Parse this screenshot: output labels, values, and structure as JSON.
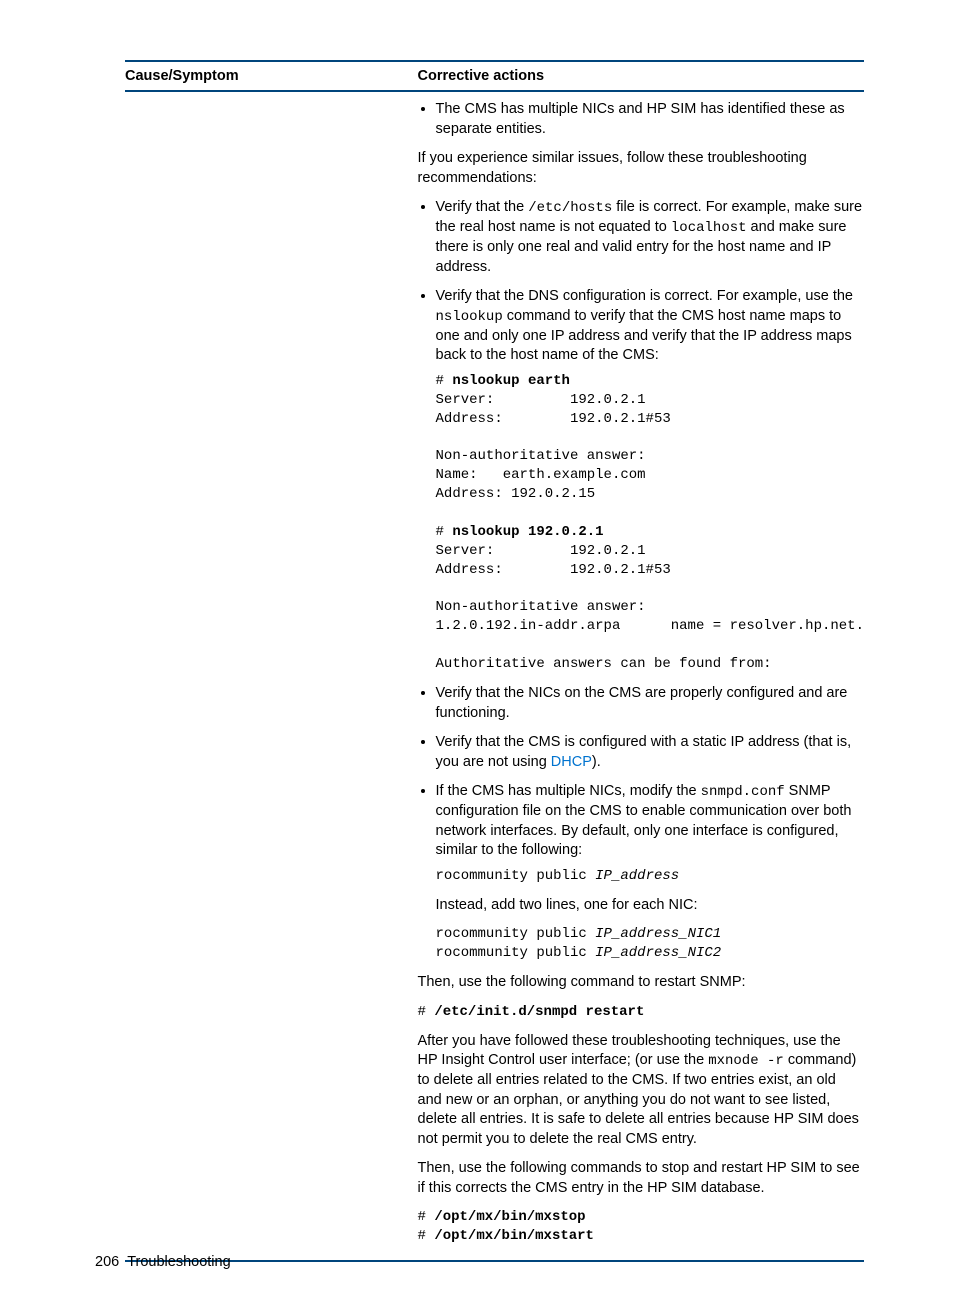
{
  "headers": {
    "col1": "Cause/Symptom",
    "col2": "Corrective actions"
  },
  "content": {
    "bullet_cms_nics": "The CMS has multiple NICs and HP SIM has identified these as separate entities.",
    "intro_troubleshoot": "If you experience similar issues, follow these troubleshooting recommendations:",
    "bullet_etc_pre": "Verify that the ",
    "bullet_etc_file": "/etc/hosts",
    "bullet_etc_mid": " file is correct. For example, make sure the real host name is not equated to ",
    "bullet_etc_localhost": "localhost",
    "bullet_etc_post": " and make sure there is only one real and valid entry for the host name and IP address.",
    "bullet_dns_pre": "Verify that the DNS configuration is correct. For example, use the ",
    "bullet_dns_cmd": "nslookup",
    "bullet_dns_post": " command to verify that the CMS host name maps to one and only one IP address and verify that the IP address maps back to the host name of the CMS:",
    "code_hash1": "# ",
    "code_nslookup_earth": "nslookup earth",
    "code_block1": "Server:         192.0.2.1\nAddress:        192.0.2.1#53\n\nNon-authoritative answer:\nName:   earth.example.com\nAddress: 192.0.2.15",
    "code_nslookup_ip": "nslookup 192.0.2.1",
    "code_block2": "Server:         192.0.2.1\nAddress:        192.0.2.1#53\n\nNon-authoritative answer:\n1.2.0.192.in-addr.arpa      name = resolver.hp.net.\n\nAuthoritative answers can be found from:",
    "bullet_nics_func": "Verify that the NICs on the CMS are properly configured and are functioning.",
    "bullet_static_pre": "Verify that the CMS is configured with a static IP address (that is, you are not using ",
    "bullet_static_link": "DHCP",
    "bullet_static_post": ").",
    "bullet_snmp_pre": "If the CMS has multiple NICs, modify the ",
    "bullet_snmp_file": "snmpd.conf",
    "bullet_snmp_post": " SNMP configuration file on the CMS to enable communication over both network interfaces. By default, only one interface is configured, similar to the following:",
    "code_ro1_pre": "rocommunity public ",
    "code_ro1_ip": "IP_address",
    "snmp_instead": "Instead, add two lines, one for each NIC:",
    "code_ro2a_pre": "rocommunity public ",
    "code_ro2a_ip": "IP_address_NIC1",
    "code_ro2b_pre": "rocommunity public ",
    "code_ro2b_ip": "IP_address_NIC2",
    "restart_snmp_text": "Then, use the following command to restart SNMP:",
    "code_restart": "/etc/init.d/snmpd restart",
    "after_trouble_pre": "After you have followed these troubleshooting techniques, use the HP Insight Control user interface; (or use the ",
    "after_trouble_cmd": "mxnode -r",
    "after_trouble_post": " command) to delete all entries related to the CMS. If two entries exist, an old and new or an orphan, or anything you do not want to see listed, delete all entries. It is safe to delete all entries because HP SIM does not permit you to delete the real CMS entry.",
    "then_stop_restart": "Then, use the following commands to stop and restart HP SIM to see if this corrects the CMS entry in the HP SIM database.",
    "code_mxstop": "/opt/mx/bin/mxstop",
    "code_mxstart": "/opt/mx/bin/mxstart"
  },
  "footer": {
    "page": "206",
    "section": "Troubleshooting"
  }
}
